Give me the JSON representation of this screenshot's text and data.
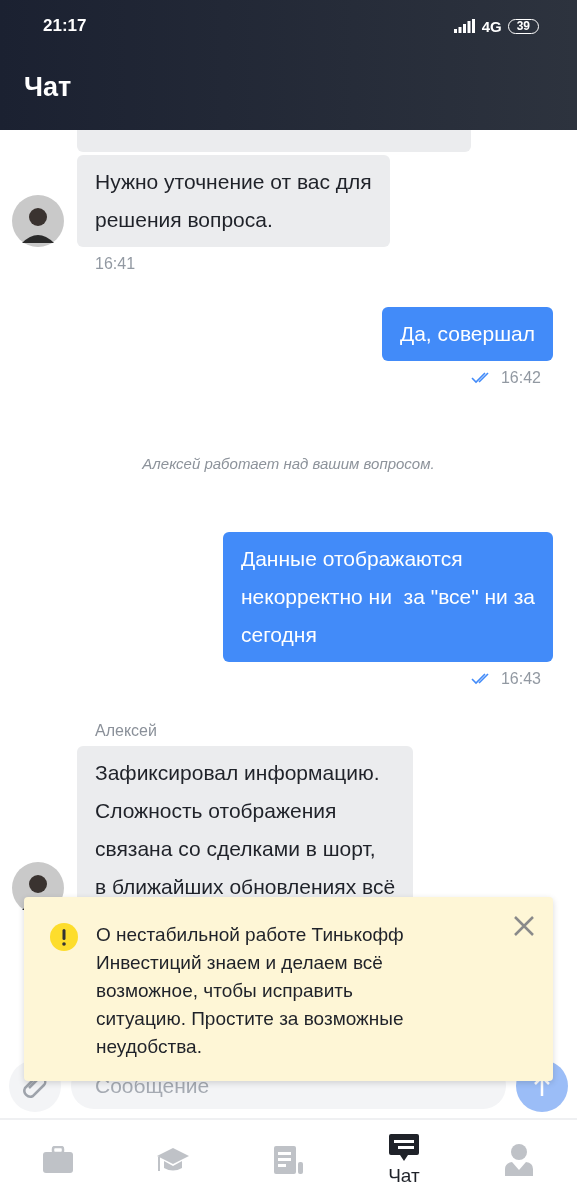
{
  "status_bar": {
    "time": "21:17",
    "network": "4G",
    "battery": "39"
  },
  "header": {
    "title": "Чат"
  },
  "messages": [
    {
      "kind": "incoming"
    },
    {
      "kind": "incoming",
      "text": "Нужно уточнение от вас для\nрешения вопроса.",
      "avatar": true,
      "time": "16:41"
    },
    {
      "kind": "outgoing",
      "text": "Да, совершал",
      "time": "16:42",
      "read": true
    },
    {
      "kind": "system",
      "text": "Алексей работает над вашим вопросом."
    },
    {
      "kind": "outgoing",
      "text": "Данные отображаются\nнекорректно ни  за \"все\" ни за\nсегодня",
      "time": "16:43",
      "read": true
    },
    {
      "kind": "incoming",
      "author": "Алексей",
      "text": "Зафиксировал информацию.\nСложность отображения\nсвязана со сделками в шорт,\nв ближайших обновлениях всё",
      "avatar": true
    }
  ],
  "banner": {
    "text": "О нестабильной работе Тинькофф\nИнвестиций знаем и делаем всё\nвозможное, чтобы исправить\nситуацию. Простите за возможные\nнеудобства."
  },
  "composer": {
    "placeholder": "Сообщение"
  },
  "nav": [
    {
      "kind": "portfolio",
      "selected": false
    },
    {
      "kind": "learning",
      "selected": false
    },
    {
      "kind": "news",
      "selected": false
    },
    {
      "kind": "chat",
      "label": "Чат",
      "selected": true
    },
    {
      "kind": "profile",
      "selected": false
    }
  ]
}
